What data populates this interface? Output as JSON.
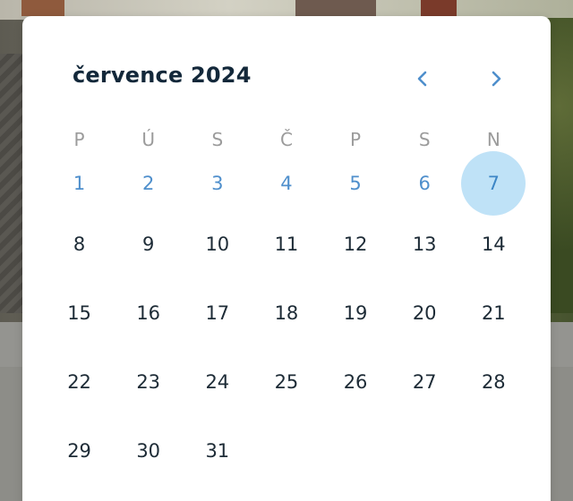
{
  "calendar": {
    "month_title": "července 2024",
    "prev_icon": "chevron-left-icon",
    "next_icon": "chevron-right-icon",
    "weekdays": [
      "P",
      "Ú",
      "S",
      "Č",
      "P",
      "S",
      "N"
    ],
    "weeks": [
      [
        "1",
        "2",
        "3",
        "4",
        "5",
        "6",
        "7"
      ],
      [
        "8",
        "9",
        "10",
        "11",
        "12",
        "13",
        "14"
      ],
      [
        "15",
        "16",
        "17",
        "18",
        "19",
        "20",
        "21"
      ],
      [
        "22",
        "23",
        "24",
        "25",
        "26",
        "27",
        "28"
      ],
      [
        "29",
        "30",
        "31",
        "",
        "",
        "",
        ""
      ]
    ],
    "selected_day": "7",
    "colors": {
      "accent": "#4f8fcc",
      "selected_bg": "#bfe2f7",
      "title": "#13283a",
      "weekday": "#9b9b9b",
      "day_text": "#1d2b36"
    }
  }
}
